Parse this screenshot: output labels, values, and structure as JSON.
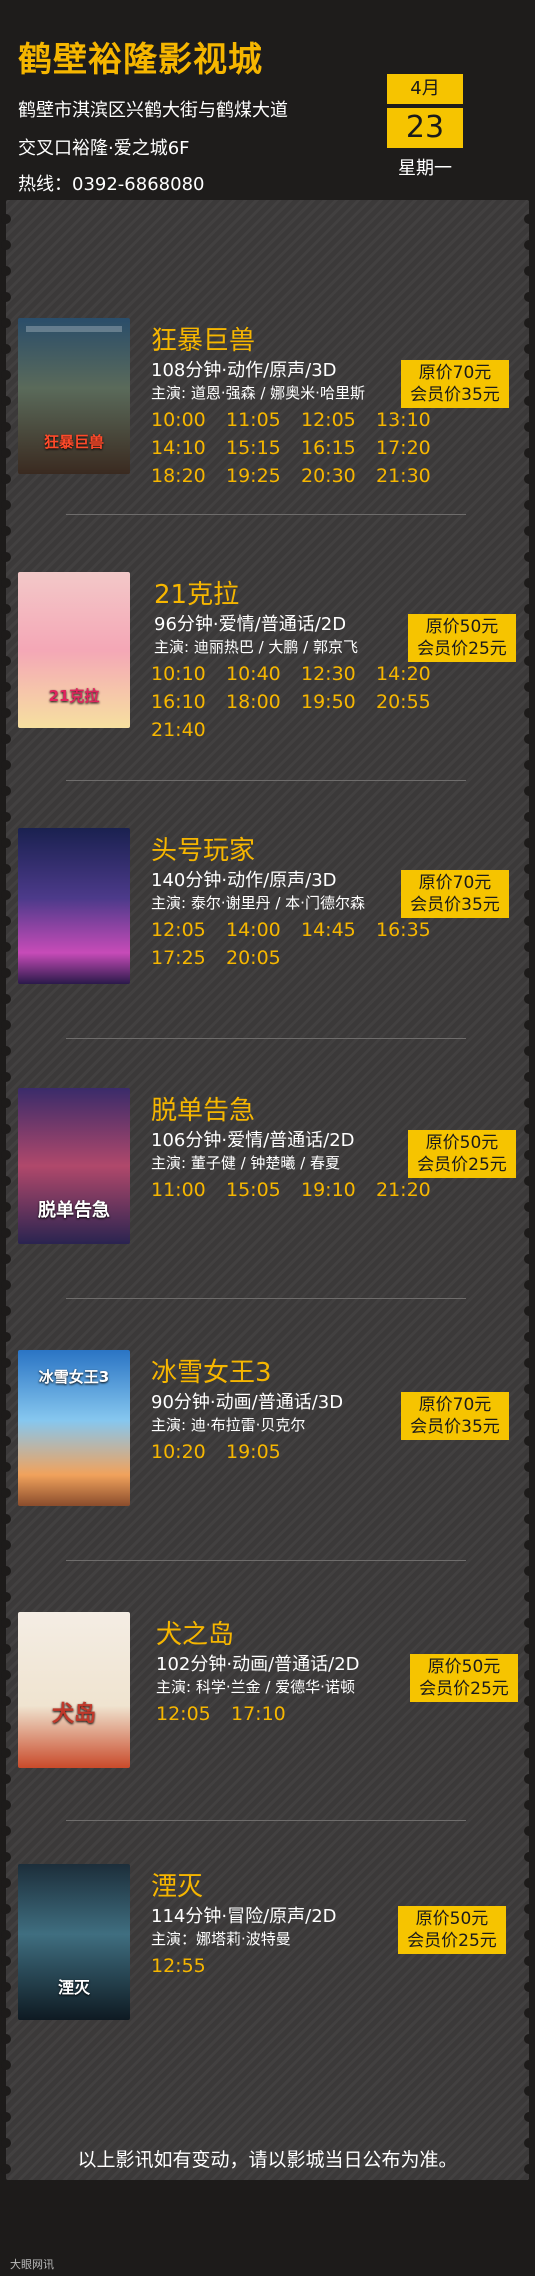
{
  "header": {
    "cinema_name": "鹤壁裕隆影视城",
    "address_line1": "鹤壁市淇滨区兴鹤大街与鹤煤大道",
    "address_line2": "交叉口裕隆·爱之城6F",
    "hotline": "热线：0392-6868080",
    "date": {
      "month": "4月",
      "day": "23",
      "weekday": "星期一"
    }
  },
  "colors": {
    "accent": "#f6c400",
    "title": "#f6b600",
    "background": "#3b3939"
  },
  "movies": [
    {
      "title": "狂暴巨兽",
      "meta": "108分钟·动作/原声/3D",
      "cast": "主演: 道恩·强森 / 娜奥米·哈里斯",
      "price_original": "原价70元",
      "price_member": "会员价35元",
      "times": [
        "10:00",
        "11:05",
        "12:05",
        "13:10",
        "14:10",
        "15:15",
        "16:15",
        "17:20",
        "18:20",
        "19:25",
        "20:30",
        "21:30"
      ],
      "poster_text": "狂暴巨兽"
    },
    {
      "title": "21克拉",
      "meta": "96分钟·爱情/普通话/2D",
      "cast": "主演: 迪丽热巴 / 大鹏 / 郭京飞",
      "price_original": "原价50元",
      "price_member": "会员价25元",
      "times": [
        "10:10",
        "10:40",
        "12:30",
        "14:20",
        "16:10",
        "18:00",
        "19:50",
        "20:55",
        "21:40"
      ],
      "poster_text": "21克拉"
    },
    {
      "title": "头号玩家",
      "meta": "140分钟·动作/原声/3D",
      "cast": "主演: 泰尔·谢里丹 / 本·门德尔森",
      "price_original": "原价70元",
      "price_member": "会员价35元",
      "times": [
        "12:05",
        "14:00",
        "14:45",
        "16:35",
        "17:25",
        "20:05"
      ],
      "poster_text": ""
    },
    {
      "title": "脱单告急",
      "meta": "106分钟·爱情/普通话/2D",
      "cast": "主演: 董子健 / 钟楚曦 / 春夏",
      "price_original": "原价50元",
      "price_member": "会员价25元",
      "times": [
        "11:00",
        "15:05",
        "19:10",
        "21:20"
      ],
      "poster_text": "脱单告急"
    },
    {
      "title": "冰雪女王3",
      "meta": "90分钟·动画/普通话/3D",
      "cast": "主演: 迪·布拉雷·贝克尔",
      "price_original": "原价70元",
      "price_member": "会员价35元",
      "times": [
        "10:20",
        "19:05"
      ],
      "poster_text": "冰雪女王3"
    },
    {
      "title": "犬之岛",
      "meta": "102分钟·动画/普通话/2D",
      "cast": "主演: 科学·兰金 / 爱德华·诺顿",
      "price_original": "原价50元",
      "price_member": "会员价25元",
      "times": [
        "12:05",
        "17:10"
      ],
      "poster_text": "犬岛"
    },
    {
      "title": "湮灭",
      "meta": "114分钟·冒险/原声/2D",
      "cast": "主演：娜塔莉·波特曼",
      "price_original": "原价50元",
      "price_member": "会员价25元",
      "times": [
        "12:55"
      ],
      "poster_text": "湮灭"
    }
  ],
  "footer_note": "以上影讯如有变动，请以影城当日公布为准。",
  "watermark": "大眼网讯"
}
